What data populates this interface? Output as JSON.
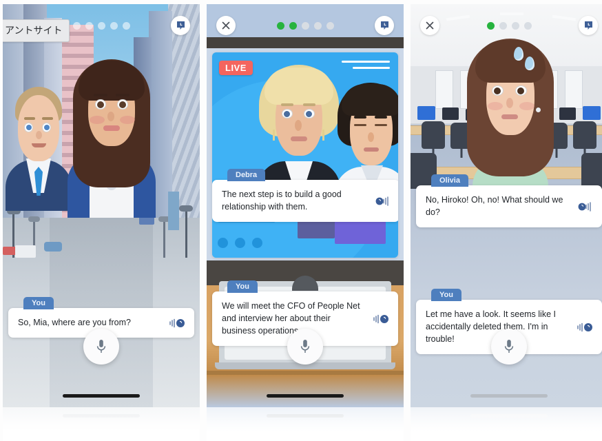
{
  "tooltip": {
    "text": "アントサイト"
  },
  "icons": {
    "close": "close-icon",
    "bookmark": "bookmark-icon",
    "mic": "microphone-icon",
    "speaker": "speaker-icon"
  },
  "panels": [
    {
      "id": "panel-city",
      "scene": "city-street",
      "close_button": false,
      "progress": {
        "total": 5,
        "completed": 0,
        "style": "faint"
      },
      "badge": null,
      "dialogues": [
        {
          "speaker": "You",
          "text": "So, Mia, where are you from?",
          "speaker_icon": "speaker-icon"
        }
      ],
      "mic_label": "microphone-icon",
      "home_bar": "dark"
    },
    {
      "id": "panel-broadcast",
      "scene": "live-broadcast",
      "close_button": true,
      "progress": {
        "total": 5,
        "completed": 2,
        "style": "normal"
      },
      "badge": {
        "label": "LIVE",
        "color": "#f4655e"
      },
      "dialogues": [
        {
          "speaker": "Debra",
          "text": "The next step is to build a good relationship with them.",
          "speaker_icon": "speaker-icon"
        },
        {
          "speaker": "You",
          "text": "We will meet the CFO of People Net and interview her about their business operations.",
          "speaker_icon": "speaker-icon"
        }
      ],
      "mic_label": "microphone-icon",
      "home_bar": "dark"
    },
    {
      "id": "panel-office",
      "scene": "office",
      "close_button": true,
      "progress": {
        "total": 4,
        "completed": 1,
        "style": "normal"
      },
      "badge": null,
      "dialogues": [
        {
          "speaker": "Olivia",
          "text": "No, Hiroko! Oh, no! What should we do?",
          "speaker_icon": "speaker-icon"
        },
        {
          "speaker": "You",
          "text": "Let me have a look. It seems like I accidentally deleted them. I'm in trouble!",
          "speaker_icon": "speaker-icon"
        }
      ],
      "mic_label": "microphone-icon",
      "home_bar": "light"
    }
  ],
  "colors": {
    "tag_blue": "#4e7fbe",
    "live_red": "#f4655e",
    "progress_green": "#27b33e",
    "broadcast_blue": "#36a9f0"
  }
}
